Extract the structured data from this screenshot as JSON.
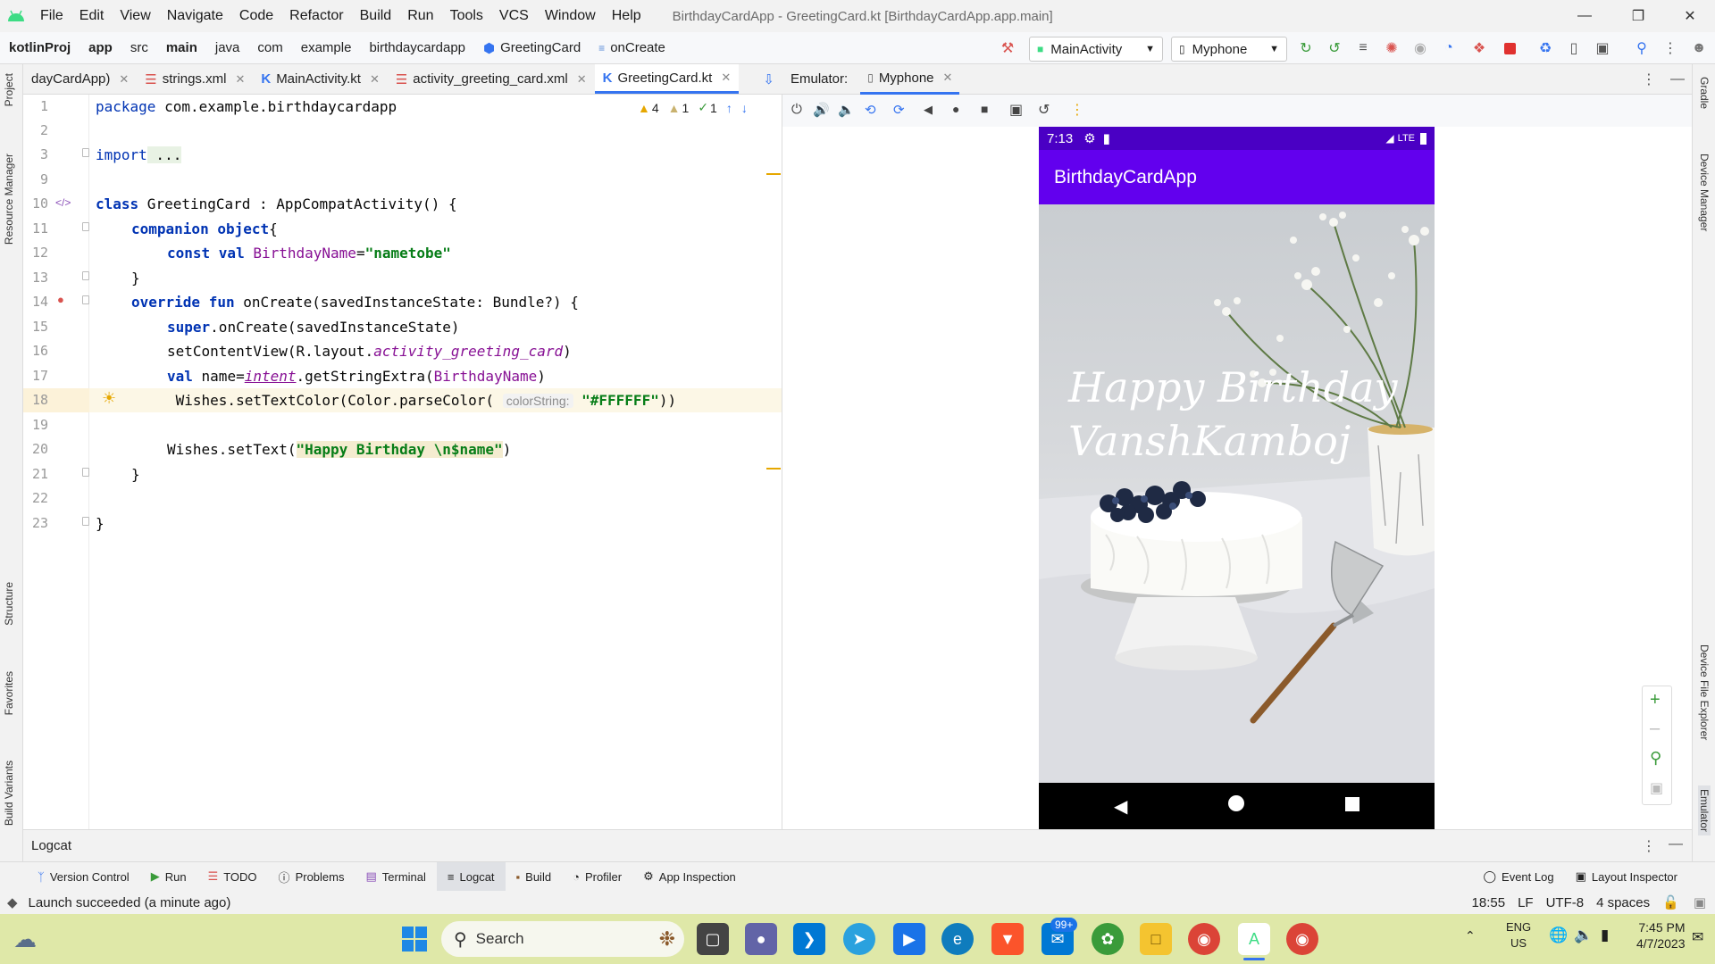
{
  "menubar": {
    "items": [
      "File",
      "Edit",
      "View",
      "Navigate",
      "Code",
      "Refactor",
      "Build",
      "Run",
      "Tools",
      "VCS",
      "Window",
      "Help"
    ],
    "window_title": "BirthdayCardApp - GreetingCard.kt [BirthdayCardApp.app.main]"
  },
  "navbar": {
    "crumbs": [
      "kotlinProj",
      "app",
      "src",
      "main",
      "java",
      "com",
      "example",
      "birthdaycardapp",
      "GreetingCard",
      "onCreate"
    ],
    "run_config": "MainActivity",
    "device": "Myphone"
  },
  "side_tabs": {
    "left": [
      "Project",
      "Resource Manager",
      "Structure",
      "Favorites",
      "Build Variants"
    ],
    "right": [
      "Gradle",
      "Device Manager",
      "Device File Explorer",
      "Emulator"
    ]
  },
  "editor_tabs": [
    {
      "label": "dayCardApp)",
      "active": false
    },
    {
      "label": "strings.xml",
      "active": false
    },
    {
      "label": "MainActivity.kt",
      "active": false
    },
    {
      "label": "activity_greeting_card.xml",
      "active": false
    },
    {
      "label": "GreetingCard.kt",
      "active": true
    }
  ],
  "inspections": {
    "warnings": "4",
    "weak_warnings": "1",
    "typos": "1"
  },
  "code": {
    "line_numbers": [
      "1",
      "2",
      "3",
      "9",
      "10",
      "11",
      "12",
      "13",
      "14",
      "15",
      "16",
      "17",
      "18",
      "19",
      "20",
      "21",
      "22",
      "23"
    ],
    "l1_kw": "package",
    "l1_rest": " com.example.birthdaycardapp",
    "l3_kw": "import",
    "l3_rest": " ...",
    "l10_kw": "class",
    "l10_rest": " GreetingCard : AppCompatActivity() {",
    "l11_kw": "companion object",
    "l11_rest": "{",
    "l12_kw": "const val",
    "l12_name": " BirthdayName",
    "l12_eq": "=",
    "l12_str": "\"nametobe\"",
    "l13": "}",
    "l14_kw": "override fun",
    "l14_rest": " onCreate(savedInstanceState: Bundle?) {",
    "l15_kw": "super",
    "l15_rest": ".onCreate(savedInstanceState)",
    "l16_pre": "setContentView(R.layout.",
    "l16_ital": "activity_greeting_card",
    "l16_post": ")",
    "l17_kw": "val",
    "l17_pre": " name=",
    "l17_und": "intent",
    "l17_mid": ".getStringExtra(",
    "l17_cst": "BirthdayName",
    "l17_post": ")",
    "l18_pre": " Wishes.setTextColor(Color.parseColor( ",
    "l18_hint": "colorString:",
    "l18_str": " \"#FFFFFF\"",
    "l18_post": "))",
    "l20_pre": "Wishes.setText(",
    "l20_str": "\"Happy Birthday \\n$name\"",
    "l20_post": ")",
    "l21": "}",
    "l23": "}"
  },
  "emulator": {
    "label": "Emulator:",
    "device_tab": "Myphone",
    "phone": {
      "time": "7:13",
      "network": "LTE",
      "app_title": "BirthdayCardApp",
      "wishes_line1": "Happy Birthday",
      "wishes_line2": "VanshKamboj"
    }
  },
  "logcat_title": "Logcat",
  "bottom_tabs": [
    "Version Control",
    "Run",
    "TODO",
    "Problems",
    "Terminal",
    "Logcat",
    "Build",
    "Profiler",
    "App Inspection"
  ],
  "bottom_right_tabs": [
    "Event Log",
    "Layout Inspector"
  ],
  "status": {
    "message": "Launch succeeded (a minute ago)",
    "position": "18:55",
    "line_sep": "LF",
    "encoding": "UTF-8",
    "indent": "4 spaces"
  },
  "taskbar": {
    "search_placeholder": "Search",
    "mail_badge": "99+",
    "lang_top": "ENG",
    "lang_bottom": "US",
    "time": "7:45 PM",
    "date": "4/7/2023"
  }
}
